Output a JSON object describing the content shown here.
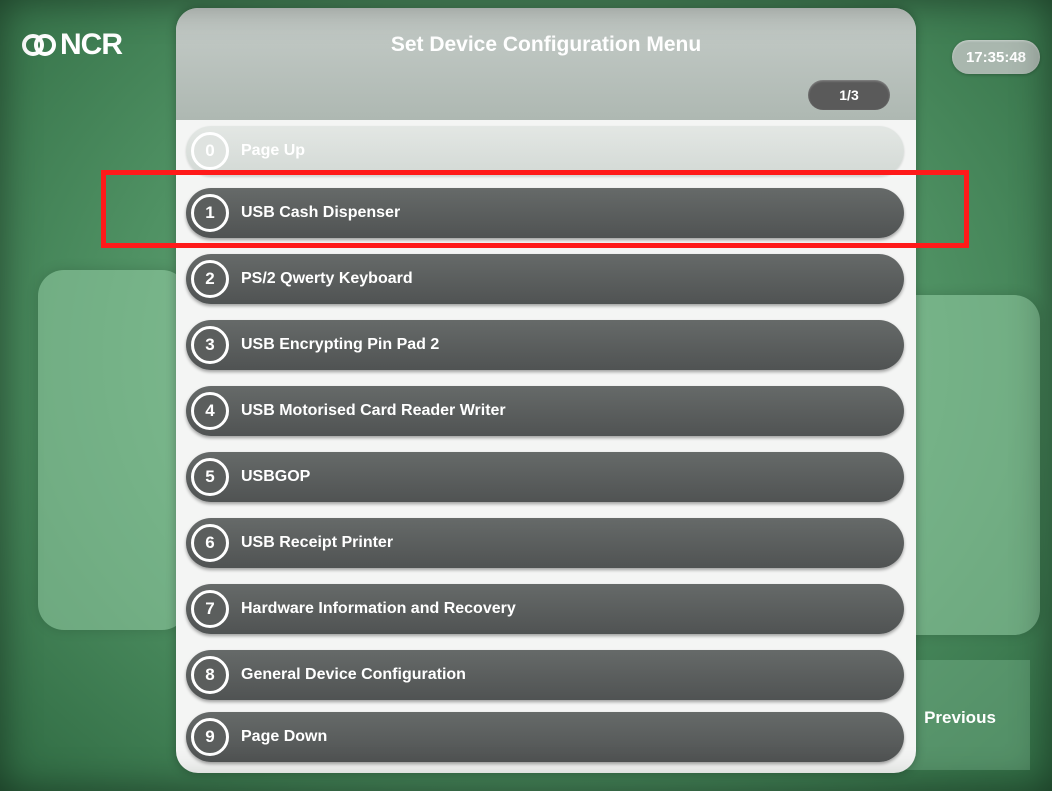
{
  "brand": {
    "logo_text": "NCR"
  },
  "clock": "17:35:48",
  "title": "Set Device Configuration Menu",
  "page_indicator": "1/3",
  "menu_items": [
    {
      "num": "0",
      "label": "Page Up",
      "enabled": false
    },
    {
      "num": "1",
      "label": "USB Cash Dispenser",
      "enabled": true,
      "highlighted": true
    },
    {
      "num": "2",
      "label": "PS/2 Qwerty Keyboard",
      "enabled": true
    },
    {
      "num": "3",
      "label": "USB Encrypting Pin Pad 2",
      "enabled": true
    },
    {
      "num": "4",
      "label": "USB Motorised Card Reader Writer",
      "enabled": true
    },
    {
      "num": "5",
      "label": "USBGOP",
      "enabled": true
    },
    {
      "num": "6",
      "label": "USB Receipt Printer",
      "enabled": true
    },
    {
      "num": "7",
      "label": "Hardware Information and Recovery",
      "enabled": true
    },
    {
      "num": "8",
      "label": "General Device Configuration",
      "enabled": true
    },
    {
      "num": "9",
      "label": "Page Down",
      "enabled": true
    }
  ],
  "previous_label": "Previous",
  "colors": {
    "background": "#4f9163",
    "menu_item": "#5b5e5d",
    "highlight": "#ff1a1a"
  }
}
